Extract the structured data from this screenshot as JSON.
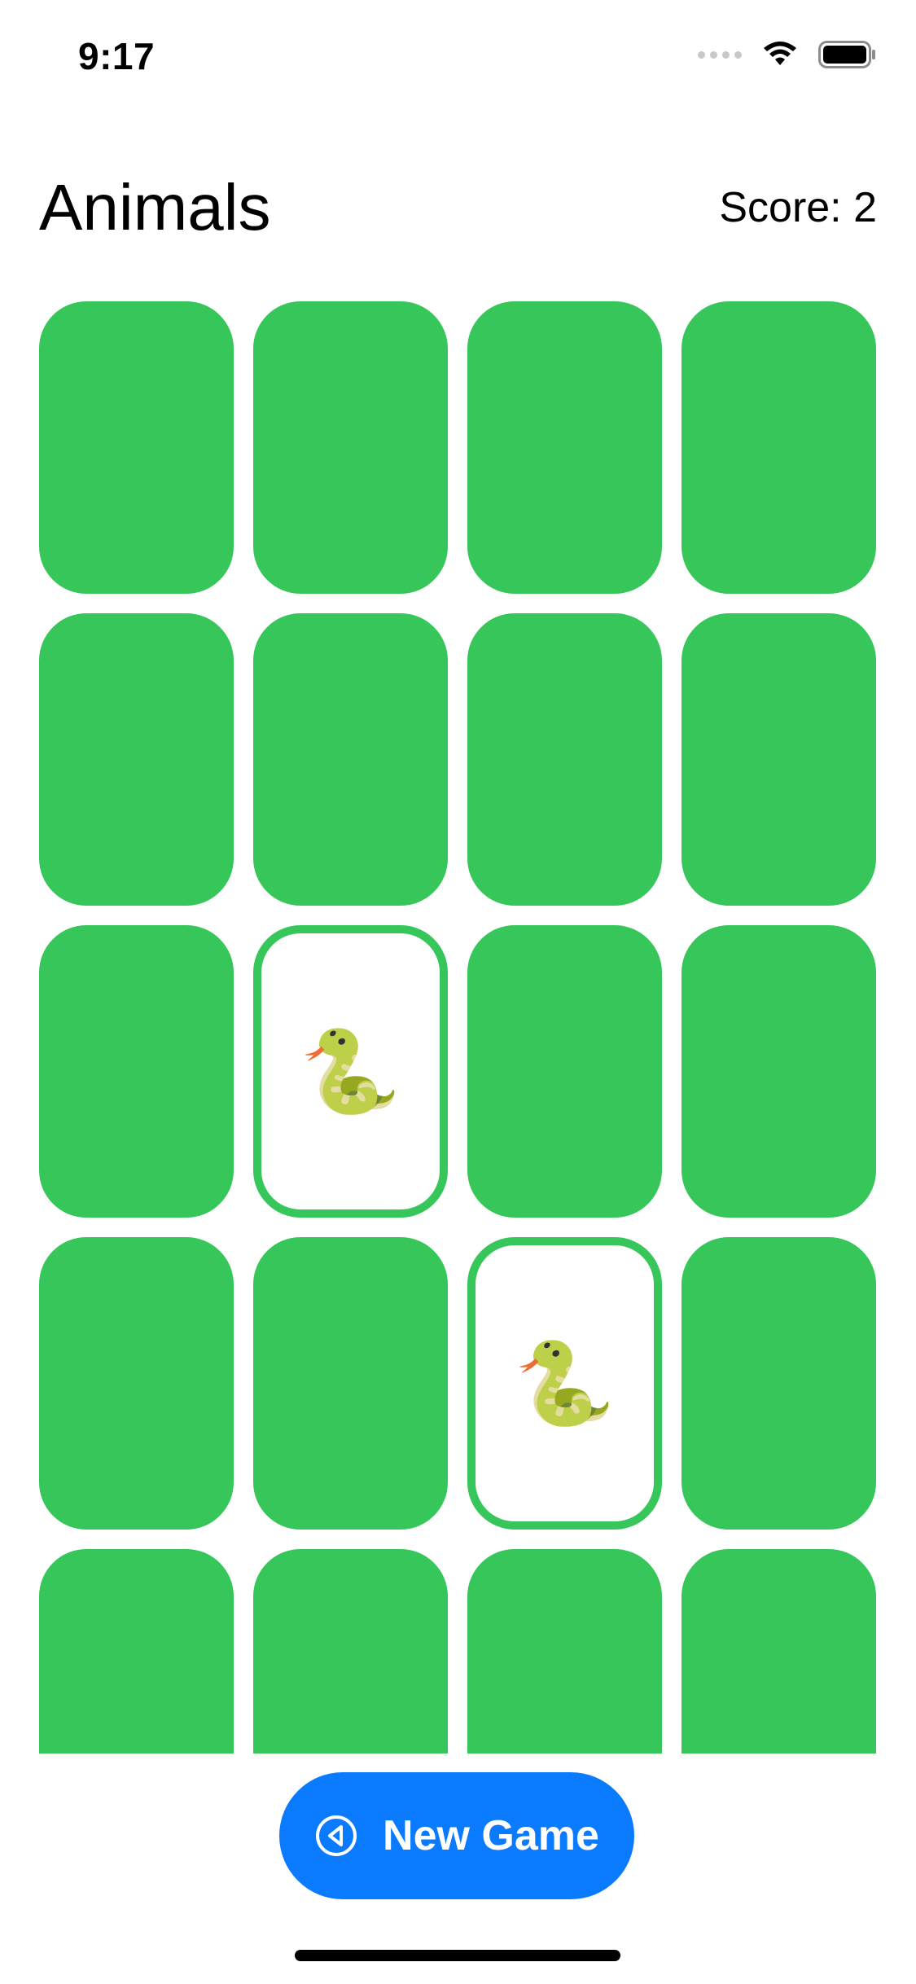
{
  "status_bar": {
    "time": "9:17"
  },
  "header": {
    "title": "Animals",
    "score_text": "Score: 2"
  },
  "colors": {
    "card_back": "#37c65a",
    "accent_button": "#0a7aff"
  },
  "cards": [
    {
      "face_up": false,
      "symbol": ""
    },
    {
      "face_up": false,
      "symbol": ""
    },
    {
      "face_up": false,
      "symbol": ""
    },
    {
      "face_up": false,
      "symbol": ""
    },
    {
      "face_up": false,
      "symbol": ""
    },
    {
      "face_up": false,
      "symbol": ""
    },
    {
      "face_up": false,
      "symbol": ""
    },
    {
      "face_up": false,
      "symbol": ""
    },
    {
      "face_up": false,
      "symbol": ""
    },
    {
      "face_up": true,
      "symbol": "🐍"
    },
    {
      "face_up": false,
      "symbol": ""
    },
    {
      "face_up": false,
      "symbol": ""
    },
    {
      "face_up": false,
      "symbol": ""
    },
    {
      "face_up": false,
      "symbol": ""
    },
    {
      "face_up": true,
      "symbol": "🐍"
    },
    {
      "face_up": false,
      "symbol": ""
    },
    {
      "face_up": false,
      "symbol": ""
    },
    {
      "face_up": false,
      "symbol": ""
    },
    {
      "face_up": false,
      "symbol": ""
    },
    {
      "face_up": false,
      "symbol": ""
    }
  ],
  "new_game_button": {
    "label": "New Game",
    "icon": "back-circle-icon"
  }
}
